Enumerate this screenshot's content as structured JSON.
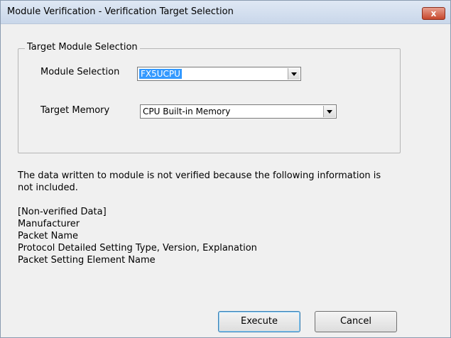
{
  "window": {
    "title": "Module Verification - Verification Target Selection",
    "close_glyph": "x"
  },
  "group": {
    "legend": "Target Module Selection",
    "module_selection": {
      "label": "Module Selection",
      "value": "FX5UCPU"
    },
    "target_memory": {
      "label": "Target Memory",
      "value": "CPU Built-in Memory"
    }
  },
  "message": {
    "line1": "The data written to module is not verified because the following information is",
    "line2": "not included.",
    "heading": "[Non-verified Data]",
    "items": [
      "Manufacturer",
      "Packet Name",
      "Protocol Detailed Setting Type, Version, Explanation",
      "Packet Setting Element Name"
    ]
  },
  "buttons": {
    "execute": "Execute",
    "cancel": "Cancel"
  },
  "colors": {
    "selection": "#3399ff",
    "close_button": "#c6472c"
  }
}
